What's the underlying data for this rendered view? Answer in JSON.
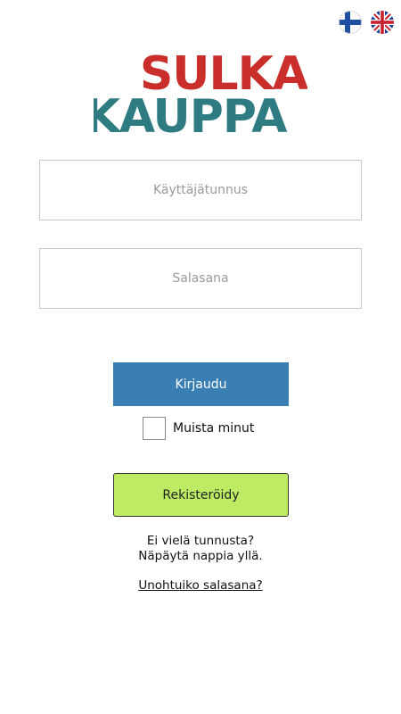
{
  "language": {
    "options": [
      {
        "code": "fi",
        "icon": "finland-flag-icon"
      },
      {
        "code": "en",
        "icon": "uk-flag-icon"
      }
    ]
  },
  "logo": {
    "line1": "SULKA",
    "line2": "KAUPPA",
    "colors": {
      "line1": "#c92e2a",
      "line2": "#2e7b82"
    }
  },
  "form": {
    "username_placeholder": "Käyttäjätunnus",
    "username_value": "",
    "password_placeholder": "Salasana",
    "password_value": "",
    "login_label": "Kirjaudu",
    "remember_label": "Muista minut",
    "remember_checked": false
  },
  "register": {
    "button_label": "Rekisteröidy",
    "hint_line1": "Ei vielä tunnusta?",
    "hint_line2": "Näpäytä nappia yllä."
  },
  "forgot_password_label": "Unohtuiko salasana?",
  "colors": {
    "login_button": "#3a7fb4",
    "register_button": "#bdeb64",
    "input_border": "#c8c8c8"
  }
}
